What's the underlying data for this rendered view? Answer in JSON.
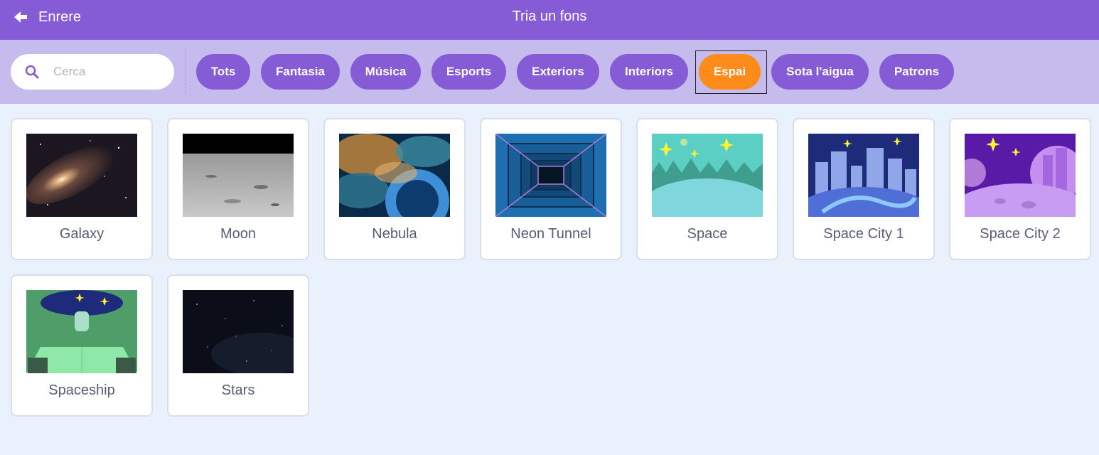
{
  "header": {
    "back_label": "Enrere",
    "title": "Tria un fons"
  },
  "search": {
    "placeholder": "Cerca",
    "value": ""
  },
  "tags": [
    {
      "label": "Tots",
      "active": false
    },
    {
      "label": "Fantasia",
      "active": false
    },
    {
      "label": "Música",
      "active": false
    },
    {
      "label": "Esports",
      "active": false
    },
    {
      "label": "Exteriors",
      "active": false
    },
    {
      "label": "Interiors",
      "active": false
    },
    {
      "label": "Espai",
      "active": true
    },
    {
      "label": "Sota l'aigua",
      "active": false
    },
    {
      "label": "Patrons",
      "active": false
    }
  ],
  "backdrops": [
    {
      "name": "Galaxy"
    },
    {
      "name": "Moon"
    },
    {
      "name": "Nebula"
    },
    {
      "name": "Neon Tunnel"
    },
    {
      "name": "Space"
    },
    {
      "name": "Space City 1"
    },
    {
      "name": "Space City 2"
    },
    {
      "name": "Spaceship"
    },
    {
      "name": "Stars"
    }
  ],
  "colors": {
    "header": "#855cd6",
    "filterbar": "#c6bbed",
    "active_tag": "#ff8c1a",
    "background": "#e9f1fc"
  }
}
